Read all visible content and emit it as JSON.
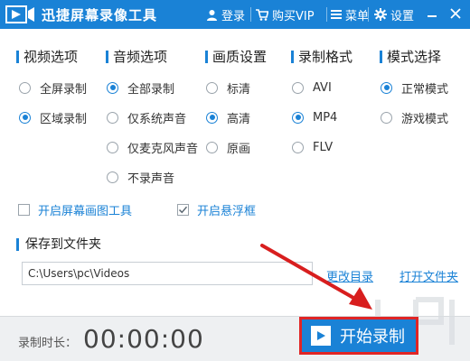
{
  "app": {
    "title": "迅捷屏幕录像工具"
  },
  "titlebar": {
    "login": "登录",
    "buy_vip": "购买VIP",
    "menu": "菜单",
    "settings": "设置"
  },
  "sections": {
    "video": {
      "title": "视频选项",
      "options": [
        {
          "label": "全屏录制",
          "selected": false
        },
        {
          "label": "区域录制",
          "selected": true
        }
      ]
    },
    "audio": {
      "title": "音频选项",
      "options": [
        {
          "label": "全部录制",
          "selected": true
        },
        {
          "label": "仅系统声音",
          "selected": false
        },
        {
          "label": "仅麦克风声音",
          "selected": false
        },
        {
          "label": "不录声音",
          "selected": false
        }
      ]
    },
    "quality": {
      "title": "画质设置",
      "options": [
        {
          "label": "标清",
          "selected": false
        },
        {
          "label": "高清",
          "selected": true
        },
        {
          "label": "原画",
          "selected": false
        }
      ]
    },
    "format": {
      "title": "录制格式",
      "options": [
        {
          "label": "AVI",
          "selected": false
        },
        {
          "label": "MP4",
          "selected": true
        },
        {
          "label": "FLV",
          "selected": false
        }
      ]
    },
    "mode": {
      "title": "模式选择",
      "options": [
        {
          "label": "正常模式",
          "selected": true
        },
        {
          "label": "游戏模式",
          "selected": false
        }
      ]
    }
  },
  "checkboxes": {
    "drawing_tool": {
      "label": "开启屏幕画图工具",
      "checked": false
    },
    "floating_frame": {
      "label": "开启悬浮框",
      "checked": true
    }
  },
  "folder": {
    "title": "保存到文件夹",
    "path": "C:\\Users\\pc\\Videos",
    "change_dir": "更改目录",
    "open_folder": "打开文件夹"
  },
  "bottom": {
    "timer_label": "录制时长：",
    "timer_value": "00:00:00",
    "start_label": "开始录制"
  },
  "colors": {
    "accent": "#1a82d6",
    "highlight_border": "#e02525"
  },
  "icons": {
    "logo": "video-camera-logo",
    "login": "user-icon",
    "buy_vip": "cart-icon",
    "menu": "menu-icon",
    "settings": "gear-icon",
    "minimize": "minimize-icon",
    "close": "close-icon",
    "start": "play-icon"
  }
}
